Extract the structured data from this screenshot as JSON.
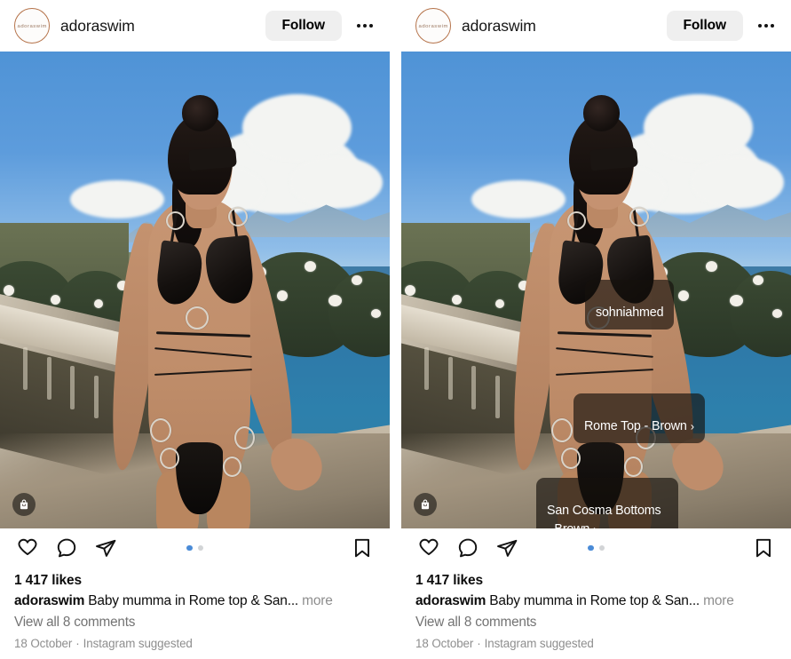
{
  "panels": [
    {
      "header": {
        "avatar_label": "adoraswim",
        "username": "adoraswim",
        "follow_label": "Follow",
        "more_label": "More options"
      },
      "media": {
        "shop_badge_icon": "shopping-bag-icon",
        "tags": []
      },
      "actions": {
        "like_icon": "heart-icon",
        "comment_icon": "comment-icon",
        "share_icon": "share-icon",
        "save_icon": "bookmark-icon",
        "dots": [
          {
            "active": true
          },
          {
            "active": false
          }
        ]
      },
      "meta": {
        "likes": "1 417 likes",
        "caption_user": "adoraswim",
        "caption_text": "Baby mumma in Rome top & San...",
        "caption_more": "more",
        "comments": "View all 8 comments",
        "date": "18 October",
        "separator": "·",
        "source": "Instagram suggested"
      }
    },
    {
      "header": {
        "avatar_label": "adoraswim",
        "username": "adoraswim",
        "follow_label": "Follow",
        "more_label": "More options"
      },
      "media": {
        "shop_badge_icon": "shopping-bag-icon",
        "tags": [
          {
            "label": "sohniahmed",
            "chevron": false
          },
          {
            "label": "Rome Top - Brown",
            "chevron": true
          },
          {
            "label": "San Cosma Bottoms - Brown",
            "chevron": true
          }
        ]
      },
      "actions": {
        "like_icon": "heart-icon",
        "comment_icon": "comment-icon",
        "share_icon": "share-icon",
        "save_icon": "bookmark-icon",
        "dots": [
          {
            "active": true
          },
          {
            "active": false
          }
        ]
      },
      "meta": {
        "likes": "1 417 likes",
        "caption_user": "adoraswim",
        "caption_text": "Baby mumma in Rome top & San...",
        "caption_more": "more",
        "comments": "View all 8 comments",
        "date": "18 October",
        "separator": "·",
        "source": "Instagram suggested"
      }
    }
  ],
  "colors": {
    "accent_dot": "#4a8bd7",
    "follow_bg": "#efefef",
    "avatar_ring": "#b5734a",
    "tag_bg": "rgba(22,16,12,0.66)",
    "muted_text": "#8e8e8e",
    "comment_text": "#737373"
  },
  "chevron_glyph": "›"
}
